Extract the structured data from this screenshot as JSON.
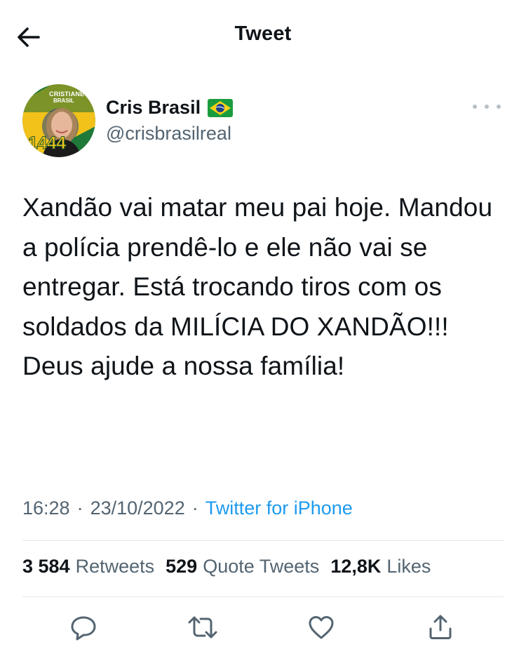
{
  "header": {
    "back_icon": "arrow-left-icon",
    "title": "Tweet"
  },
  "author": {
    "name": "Cris Brasil",
    "flag_icon": "brazil-flag-icon",
    "handle": "@crisbrasilreal",
    "avatar": {
      "banner_top": "CRISTIANE",
      "banner_bottom": "BRASIL",
      "number": "1444"
    },
    "more_icon": "more-horizontal-icon"
  },
  "tweet": {
    "text": "Xandão vai matar meu pai hoje. Mandou a polícia prendê-lo e ele não vai se entregar. Está trocando tiros com os soldados da MILÍCIA DO XANDÃO!!! Deus ajude a nossa família!"
  },
  "meta": {
    "time": "16:28",
    "sep1": "·",
    "date": "23/10/2022",
    "sep2": "·",
    "source": "Twitter for iPhone"
  },
  "stats": {
    "retweets": {
      "count": "3 584",
      "label": "Retweets"
    },
    "quotes": {
      "count": "529",
      "label": "Quote Tweets"
    },
    "likes": {
      "count": "12,8K",
      "label": "Likes"
    }
  },
  "actions": [
    {
      "name": "reply",
      "icon": "reply-icon"
    },
    {
      "name": "retweet",
      "icon": "retweet-icon"
    },
    {
      "name": "like",
      "icon": "heart-icon"
    },
    {
      "name": "share",
      "icon": "share-icon"
    }
  ],
  "colors": {
    "text": "#0f1419",
    "secondary": "#536471",
    "link": "#1d9bf0",
    "divider": "#e3e7ea"
  }
}
